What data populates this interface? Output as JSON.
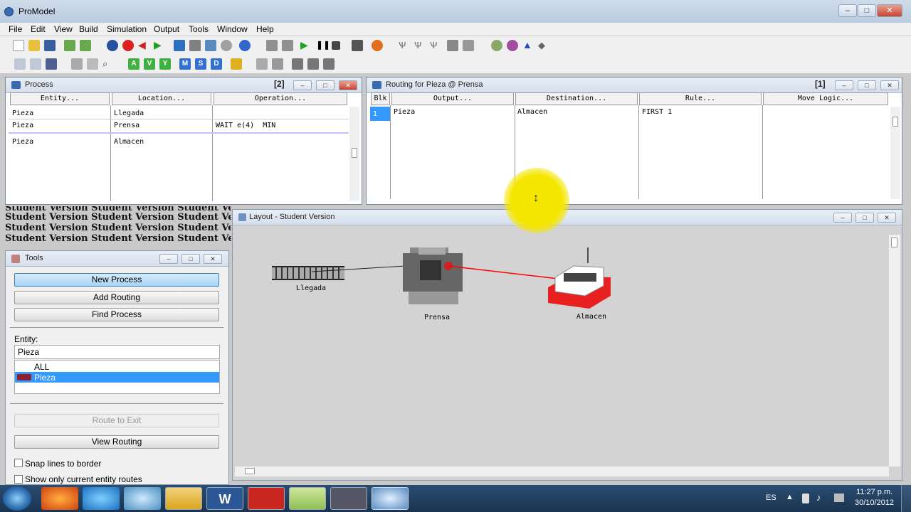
{
  "app": {
    "title": "ProModel"
  },
  "menu": [
    "File",
    "Edit",
    "View",
    "Build",
    "Simulation",
    "Output",
    "Tools",
    "Window",
    "Help"
  ],
  "process_window": {
    "title": "Process",
    "badge": "[2]",
    "columns": [
      "Entity...",
      "Location...",
      "Operation..."
    ],
    "rows": [
      {
        "entity": "Pieza",
        "location": "Llegada",
        "operation": ""
      },
      {
        "entity": "Pieza",
        "location": "Prensa",
        "operation": "WAIT e(4)  MIN"
      },
      {
        "entity": "Pieza",
        "location": "Almacen",
        "operation": ""
      }
    ]
  },
  "routing_window": {
    "title": "Routing for Pieza @ Prensa",
    "badge": "[1]",
    "columns": [
      "Blk",
      "Output...",
      "Destination...",
      "Rule...",
      "Move Logic..."
    ],
    "rows": [
      {
        "blk": "1",
        "output": "Pieza",
        "destination": "Almacen",
        "rule": "FIRST 1",
        "move_logic": ""
      }
    ]
  },
  "watermark": "Student Version Student Version Student Version Stu",
  "tools_window": {
    "title": "Tools",
    "buttons": [
      "New Process",
      "Add Routing",
      "Find Process"
    ],
    "entity_label": "Entity:",
    "entity_value": "Pieza",
    "entity_list": [
      "ALL",
      "Pieza"
    ],
    "route_to_exit": "Route to Exit",
    "view_routing": "View Routing",
    "snap_lines": "Snap lines to border",
    "show_only": "Show only current entity routes"
  },
  "layout_window": {
    "title": "Layout - Student Version",
    "locations": [
      "Llegada",
      "Prensa",
      "Almacen"
    ]
  },
  "taskbar": {
    "lang": "ES",
    "time": "11:27 p.m.",
    "date": "30/10/2012"
  },
  "colors": {
    "selection": "#3399ff",
    "route_line": "#ff0000",
    "cursor_highlight": "#f5e600"
  }
}
